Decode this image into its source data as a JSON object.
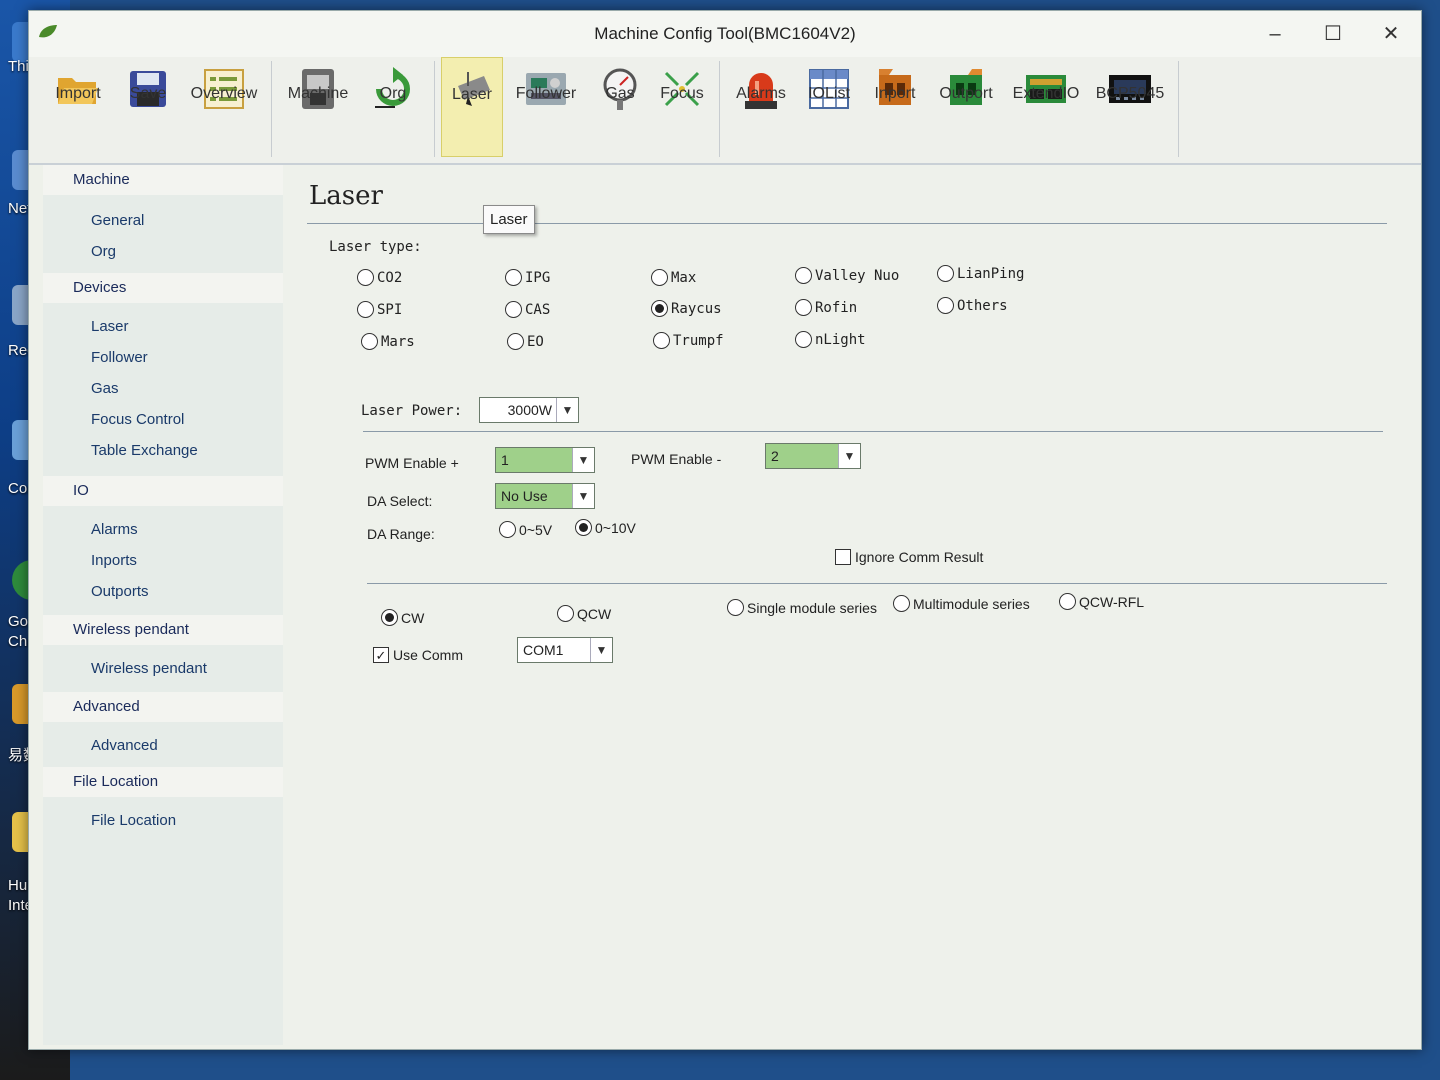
{
  "window": {
    "title": "Machine Config Tool(BMC1604V2)"
  },
  "desktop": {
    "labels": [
      "Thi",
      "Net",
      "Recy",
      "Contr",
      "Go\nChr",
      "易数",
      "Hu\nInte"
    ]
  },
  "toolbar": {
    "items": [
      {
        "id": "import",
        "label": "Import",
        "icon": "folder-open-icon"
      },
      {
        "id": "save",
        "label": "Save",
        "icon": "floppy-disk-icon"
      },
      {
        "id": "overview",
        "label": "Overview",
        "icon": "list-icon"
      },
      {
        "id": "machine",
        "label": "Machine",
        "icon": "machine-icon"
      },
      {
        "id": "org",
        "label": "Org",
        "icon": "origin-arrow-icon"
      },
      {
        "id": "laser",
        "label": "Laser",
        "icon": "laser-head-icon"
      },
      {
        "id": "follower",
        "label": "Follower",
        "icon": "follower-device-icon"
      },
      {
        "id": "gas",
        "label": "Gas",
        "icon": "pressure-gauge-icon"
      },
      {
        "id": "focus",
        "label": "Focus",
        "icon": "focus-arrows-icon"
      },
      {
        "id": "alarms",
        "label": "Alarms",
        "icon": "alarm-beacon-icon"
      },
      {
        "id": "iolist",
        "label": "IOList",
        "icon": "table-grid-icon"
      },
      {
        "id": "inport",
        "label": "Inport",
        "icon": "input-port-icon"
      },
      {
        "id": "outport",
        "label": "Outport",
        "icon": "output-port-icon"
      },
      {
        "id": "extendio",
        "label": "ExtendIO",
        "icon": "circuit-board-icon"
      },
      {
        "id": "bcp5045",
        "label": "BCP5045",
        "icon": "controller-device-icon"
      }
    ],
    "active": "Laser"
  },
  "sidebar": {
    "groups": [
      {
        "title": "Machine",
        "items": [
          "General",
          "Org"
        ]
      },
      {
        "title": "Devices",
        "items": [
          "Laser",
          "Follower",
          "Gas",
          "Focus Control",
          "Table Exchange"
        ]
      },
      {
        "title": "IO",
        "items": [
          "Alarms",
          "Inports",
          "Outports"
        ]
      },
      {
        "title": "Wireless pendant",
        "items": [
          "Wireless pendant"
        ]
      },
      {
        "title": "Advanced",
        "items": [
          "Advanced"
        ]
      },
      {
        "title": "File Location",
        "items": [
          "File Location"
        ]
      }
    ]
  },
  "content": {
    "title": "Laser",
    "tooltip": "Laser",
    "laser_type_label": "Laser type:",
    "laser_types": [
      "CO2",
      "IPG",
      "Max",
      "Valley Nuo",
      "LianPing",
      "SPI",
      "CAS",
      "Raycus",
      "Rofin",
      "Others",
      "Mars",
      "EO",
      "Trumpf",
      "nLight"
    ],
    "laser_type_selected": "Raycus",
    "laser_power_label": "Laser Power:",
    "laser_power_value": "3000W",
    "pwm_plus_label": "PWM Enable +",
    "pwm_plus_value": "1",
    "pwm_minus_label": "PWM Enable -",
    "pwm_minus_value": "2",
    "da_select_label": "DA Select:",
    "da_select_value": "No Use",
    "da_range_label": "DA Range:",
    "da_range_options": [
      "0~5V",
      "0~10V"
    ],
    "da_range_selected": "0~10V",
    "ignore_comm_label": "Ignore Comm Result",
    "ignore_comm_checked": false,
    "mode_options": [
      "CW",
      "QCW",
      "Single module series",
      "Multimodule series",
      "QCW-RFL"
    ],
    "mode_selected": "CW",
    "use_comm_label": "Use Comm",
    "use_comm_checked": true,
    "comm_port_value": "COM1"
  }
}
